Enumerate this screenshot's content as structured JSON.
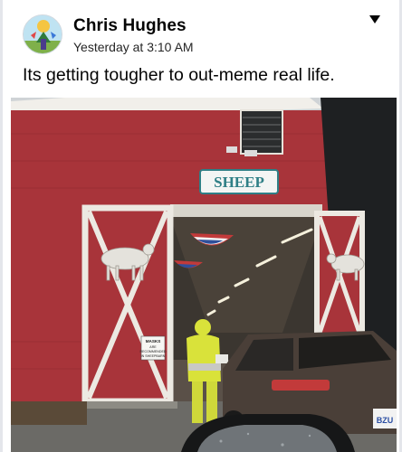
{
  "post": {
    "author": "Chris Hughes",
    "timestamp": "Yesterday at 3:10 AM",
    "text": "Its getting tougher to out-meme real life."
  },
  "photo": {
    "barn_sign": "SHEEP",
    "door_notice_line1": "MASKS",
    "door_notice_line2": "ARE",
    "door_notice_line3": "RECOMMENDED",
    "door_notice_line4": "IN SHEEPBARN",
    "plate": "BZU"
  },
  "icons": {
    "menu": "chevron-down-icon",
    "avatar": "avatar-image"
  },
  "colors": {
    "barn_red": "#a8343a",
    "trim_white": "#e9e6e0",
    "sign_teal": "#2f7f86",
    "vest_yellow": "#d9e23a"
  }
}
